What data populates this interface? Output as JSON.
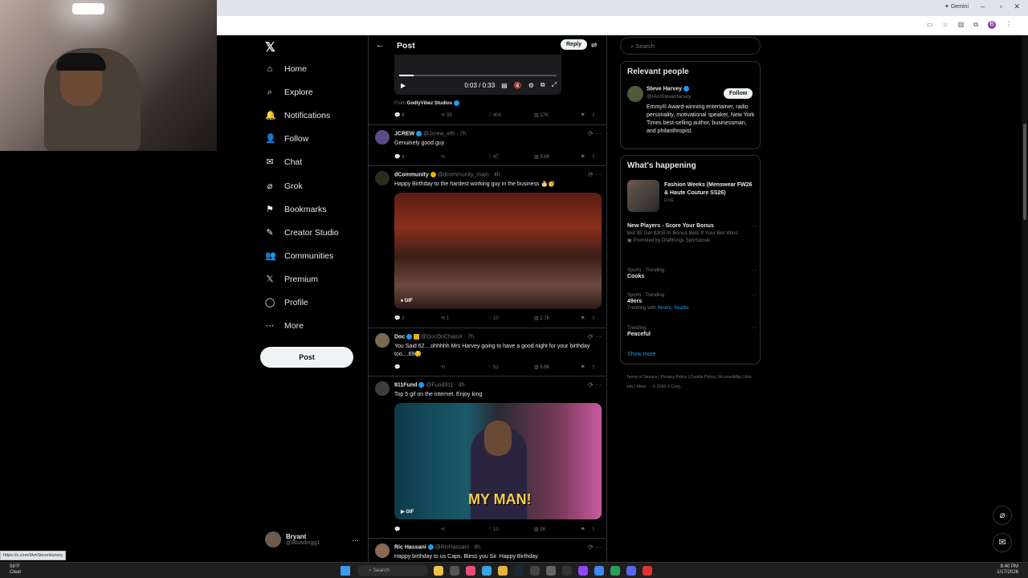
{
  "browser": {
    "gemini": "✦ Gemini"
  },
  "status_url": "https://x.com/IAmSteveHarvey",
  "nav": {
    "items": [
      {
        "label": "Home",
        "icon": "home-icon"
      },
      {
        "label": "Explore",
        "icon": "search-icon"
      },
      {
        "label": "Notifications",
        "icon": "bell-icon"
      },
      {
        "label": "Follow",
        "icon": "person-add-icon"
      },
      {
        "label": "Chat",
        "icon": "mail-icon"
      },
      {
        "label": "Grok",
        "icon": "grok-icon"
      },
      {
        "label": "Bookmarks",
        "icon": "bookmark-icon"
      },
      {
        "label": "Creator Studio",
        "icon": "creator-icon"
      },
      {
        "label": "Communities",
        "icon": "communities-icon"
      },
      {
        "label": "Premium",
        "icon": "x-icon"
      },
      {
        "label": "Profile",
        "icon": "profile-icon"
      },
      {
        "label": "More",
        "icon": "more-icon"
      }
    ],
    "post_label": "Post"
  },
  "account": {
    "name": "Bryant",
    "handle": "@Bloadingg1",
    "more": "···"
  },
  "main": {
    "title": "Post",
    "reply_label": "Reply",
    "video": {
      "time": "0:03 / 0:33",
      "progress": 0.09
    },
    "from_label": "From",
    "from_name": "GodlyVibez Studios",
    "top_actions": {
      "replies": "6",
      "reposts": "33",
      "likes": "404",
      "views": "17K"
    }
  },
  "tweets": [
    {
      "name": "JCREW",
      "handle": "@Jcrew_eth",
      "time": "· 7h",
      "text": "Genuinely good guy",
      "replies": "4",
      "reposts": "",
      "likes": "47",
      "views": "9.8K"
    },
    {
      "name": "dCommunity",
      "handle": "@dcommunity_main",
      "time": "· 4h",
      "text": "Happy Birthday to the hardest working guy in the business 🎂🥳",
      "replies": "2",
      "reposts": "1",
      "likes": "10",
      "views": "2.7K",
      "gif": "GIF"
    },
    {
      "name": "Doc",
      "handle": "@DocOnChainX",
      "time": "· 7h",
      "text": "You Said 62....ohhhhh Mrs Harvey going to have a good night for your birthday too....69😏",
      "replies": "",
      "reposts": "",
      "likes": "51",
      "views": "6.8K"
    },
    {
      "name": "911Fund",
      "handle": "@Fund911",
      "time": "· 4h",
      "text": "Top 5 gif on the internet. Enjoy king",
      "replies": "",
      "reposts": "",
      "likes": "10",
      "views": "2K",
      "gif": "GIF",
      "caption": "MY MAN!"
    },
    {
      "name": "Ric Hassani",
      "handle": "@RicHassani",
      "time": "· 8h",
      "text": "Happy birthday to us Caps. Bless you Sir. Happy Birthday."
    }
  ],
  "right": {
    "search_placeholder": "Search",
    "relevant_title": "Relevant people",
    "person": {
      "name": "Steve Harvey",
      "handle": "@IAmSteveHarvey",
      "follow": "Follow",
      "bio": "Emmy® Award-winning entertainer, radio personality, motivational speaker, New York Times best-selling author, businessman, and philanthropist."
    },
    "happening_title": "What's happening",
    "event": {
      "title": "Fashion Weeks (Menswear FW26 & Haute Couture SS26)",
      "status": "LIVE"
    },
    "promo": {
      "title": "New Players - Score Your Bonus",
      "desc": "Bet $5 Get $300 In Bonus Bets If Your Bet Wins",
      "promoted": "Promoted by DraftKings Sportsbook"
    },
    "trends": [
      {
        "meta": "Sports · Trending",
        "name": "Cooks",
        "extra": ""
      },
      {
        "meta": "Sports · Trending",
        "name": "49ers",
        "extra_prefix": "Trending with",
        "extra": "Niners, Seattle"
      },
      {
        "meta": "Trending",
        "name": "Peaceful",
        "extra": ""
      }
    ],
    "show_more": "Show more",
    "footer": "Terms of Service  |  Privacy Policy  |  Cookie Policy  |  Accessibility  |  Ads info  |  More ···  © 2026 X Corp."
  },
  "taskbar": {
    "temp": "58°F",
    "cond": "Clear",
    "search": "Search",
    "time": "8:40 PM",
    "date": "1/17/2026"
  }
}
